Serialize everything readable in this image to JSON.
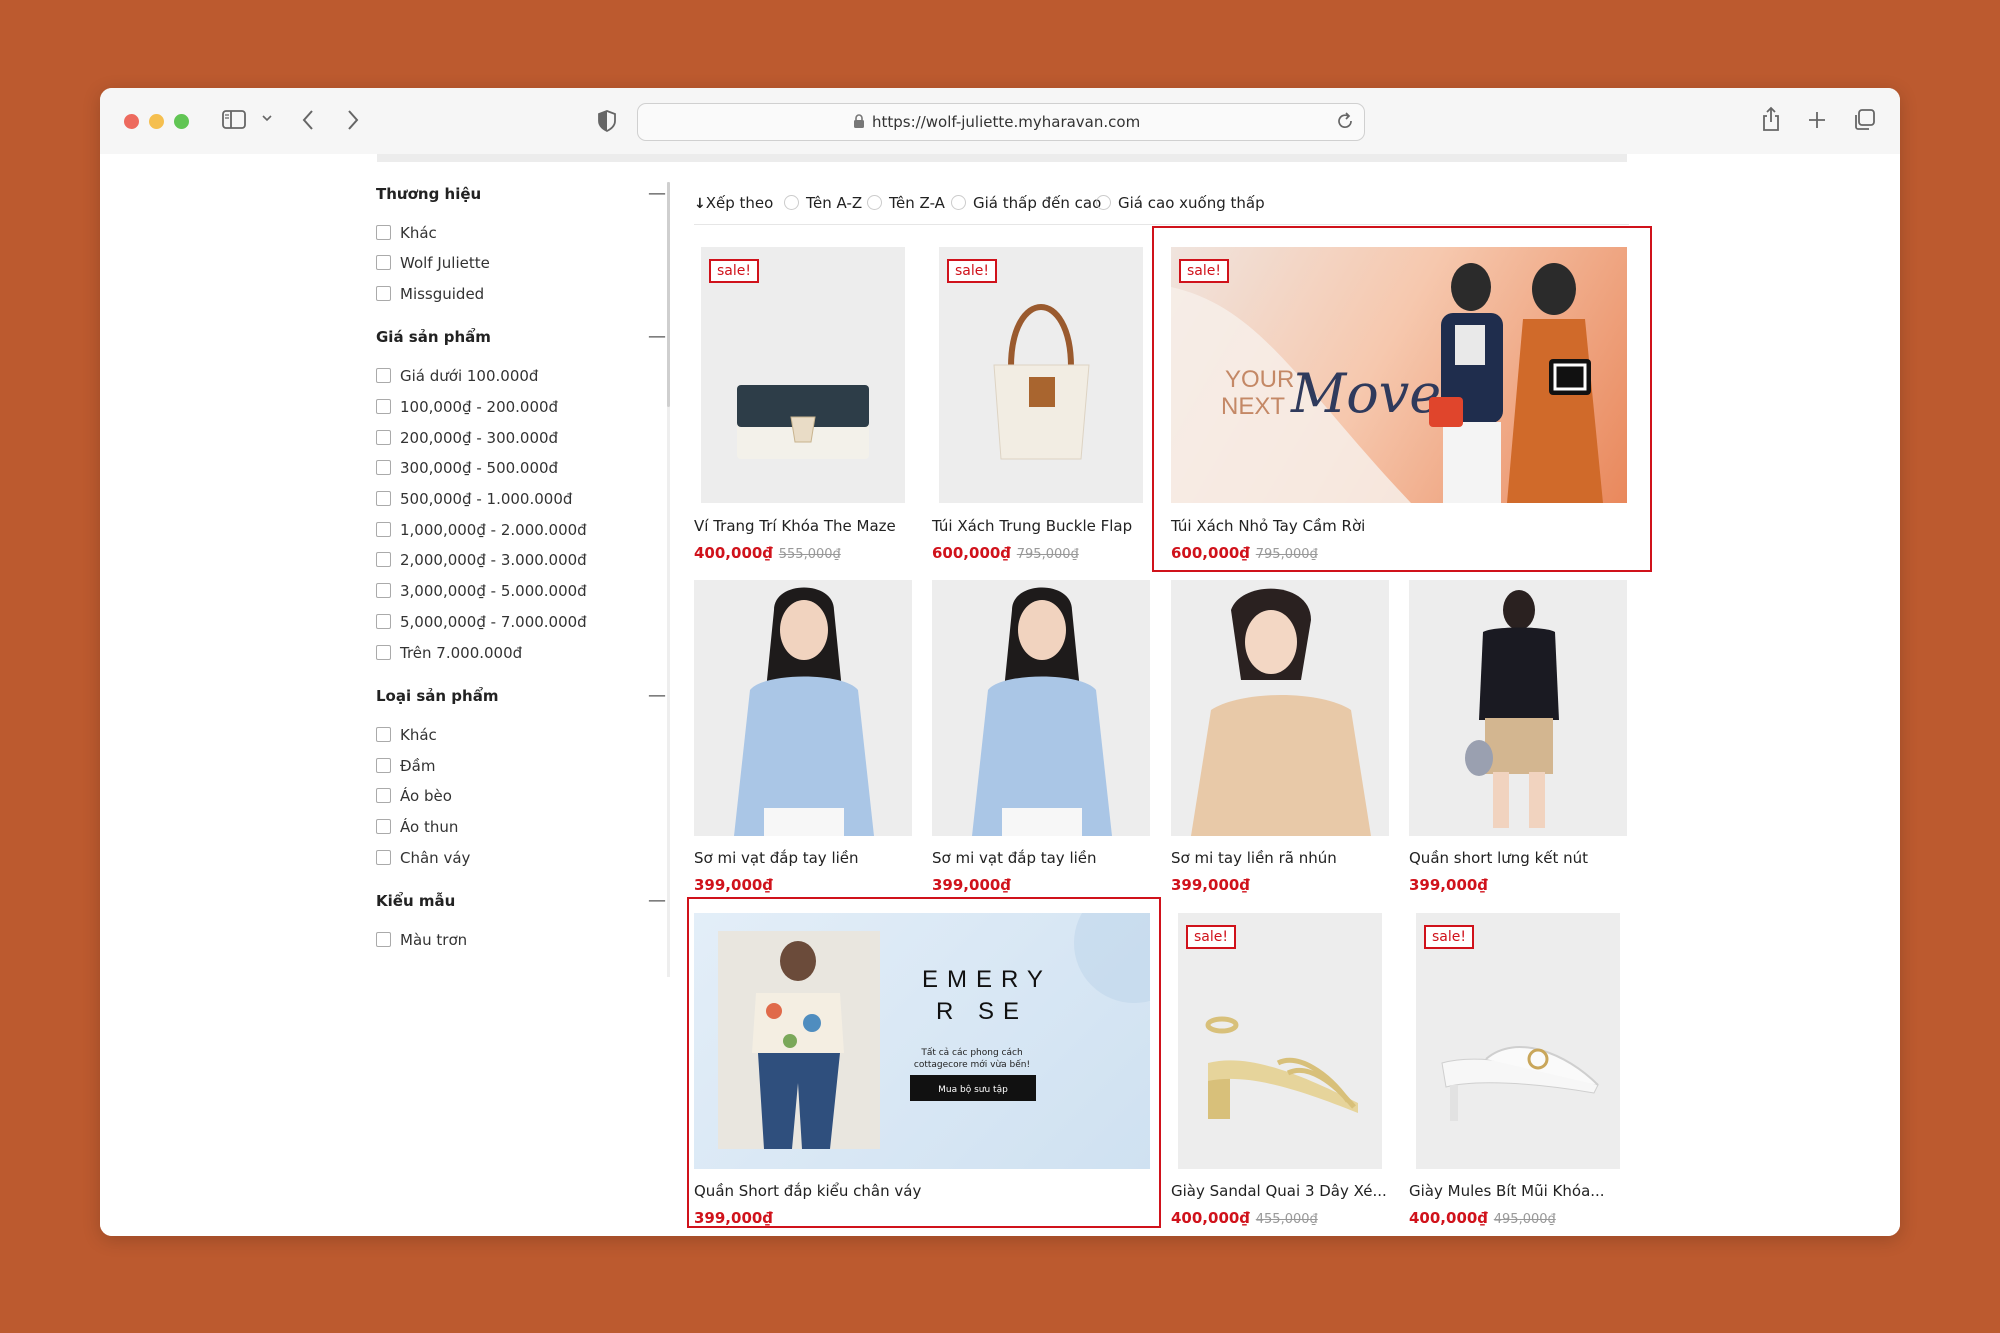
{
  "browser": {
    "url": "https://wolf-juliette.myharavan.com",
    "traffic_colors": [
      "#ed6a5e",
      "#f5bf4f",
      "#61c554"
    ]
  },
  "filters": [
    {
      "title": "Thương hiệu",
      "options": [
        "Khác",
        "Wolf Juliette",
        "Missguided"
      ]
    },
    {
      "title": "Giá sản phẩm",
      "options": [
        "Giá dưới 100.000đ",
        "100,000₫ - 200.000đ",
        "200,000₫ - 300.000đ",
        "300,000₫ - 500.000đ",
        "500,000₫ - 1.000.000đ",
        "1,000,000₫ - 2.000.000đ",
        "2,000,000₫ - 3.000.000đ",
        "3,000,000₫ - 5.000.000đ",
        "5,000,000₫ - 7.000.000đ",
        "Trên 7.000.000đ"
      ]
    },
    {
      "title": "Loại sản phẩm",
      "options": [
        "Khác",
        "Đầm",
        "Áo bèo",
        "Áo thun",
        "Chân váy"
      ]
    },
    {
      "title": "Kiểu mẫu",
      "options": [
        "Màu trơn"
      ]
    }
  ],
  "collapse_symbol": "—",
  "sort": {
    "label": "Xếp theo",
    "options": [
      "Tên A-Z",
      "Tên Z-A",
      "Giá thấp đến cao",
      "Giá cao xuống thấp"
    ]
  },
  "sale_badge": "sale!",
  "products": [
    {
      "name": "Ví Trang Trí Khóa The Maze",
      "price": "400,000₫",
      "old_price": "555,000₫"
    },
    {
      "name": "Túi Xách Trung Buckle Flap",
      "price": "600,000₫",
      "old_price": "795,000₫"
    },
    {
      "name": "Túi Xách Nhỏ Tay Cầm Rời",
      "price": "600,000₫",
      "old_price": "795,000₫"
    },
    {
      "name": "Sơ mi vạt đắp tay liền",
      "price": "399,000₫",
      "old_price": ""
    },
    {
      "name": "Sơ mi vạt đắp tay liền",
      "price": "399,000₫",
      "old_price": ""
    },
    {
      "name": "Sơ mi tay liền rã nhún",
      "price": "399,000₫",
      "old_price": ""
    },
    {
      "name": "Quần short lưng kết nút",
      "price": "399,000₫",
      "old_price": ""
    },
    {
      "name": "Quần Short đắp kiểu chân váy",
      "price": "399,000₫",
      "old_price": ""
    },
    {
      "name": "Giày Sandal Quai 3 Dây Xé...",
      "price": "400,000₫",
      "old_price": "455,000₫"
    },
    {
      "name": "Giày Mules Bít Mũi Khóa...",
      "price": "400,000₫",
      "old_price": "495,000₫"
    }
  ],
  "banner_your_move": {
    "line1": "YOUR",
    "line2": "NEXT",
    "script": "Move"
  },
  "banner_emery": {
    "brand_top": "EMERY",
    "brand_bottom": "R  SE",
    "tagline_1": "Tất cả các phong cách",
    "tagline_2": "cottagecore mới vừa bến!",
    "cta": "Mua bộ sưu tập"
  },
  "colors": {
    "accent": "#d0121b",
    "background": "#bc5a2f"
  }
}
